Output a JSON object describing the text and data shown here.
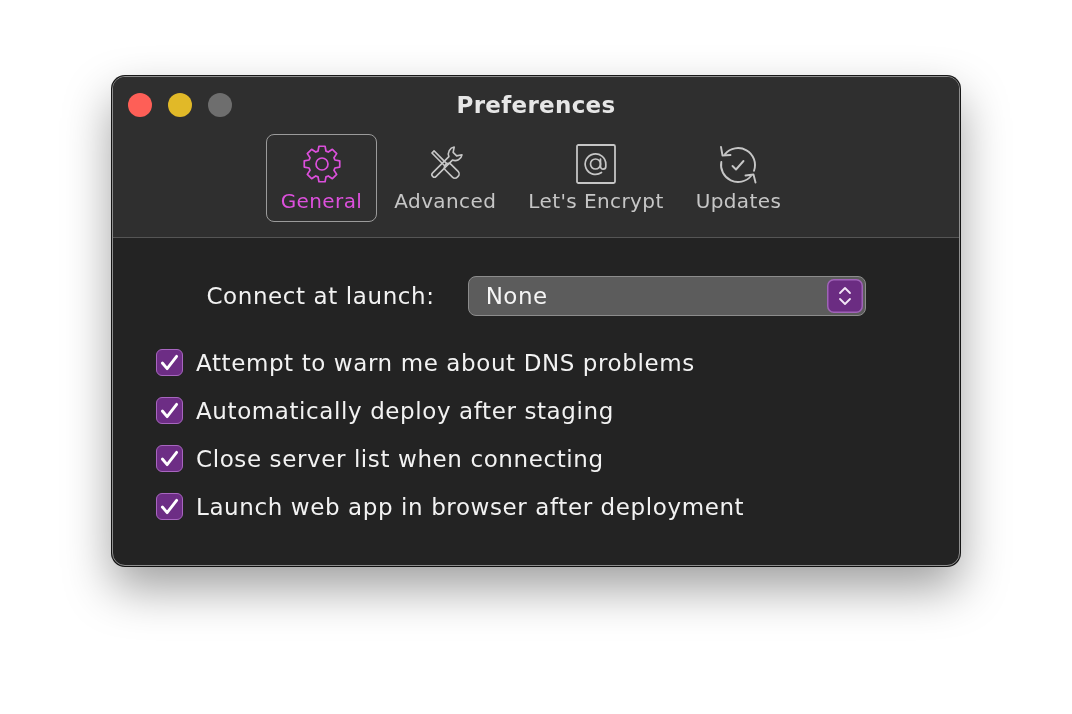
{
  "window": {
    "title": "Preferences",
    "controls": [
      {
        "color": "#fe5f57"
      },
      {
        "color": "#e1b928"
      },
      {
        "color": "#6e6e6e"
      }
    ]
  },
  "toolbar_tabs": [
    {
      "label": "General",
      "kind": "gear",
      "selected": true
    },
    {
      "label": "Advanced",
      "kind": "tools",
      "selected": false
    },
    {
      "label": "Let's Encrypt",
      "kind": "at",
      "selected": false
    },
    {
      "label": "Updates",
      "kind": "sync",
      "selected": false
    }
  ],
  "connect_at_launch": {
    "label": "Connect at launch:",
    "value": "None"
  },
  "options": [
    {
      "label": "Attempt to warn me about DNS problems",
      "checked": true
    },
    {
      "label": "Automatically deploy after staging",
      "checked": true
    },
    {
      "label": "Close server list when connecting",
      "checked": true
    },
    {
      "label": "Launch web app in browser after deployment",
      "checked": true
    }
  ]
}
